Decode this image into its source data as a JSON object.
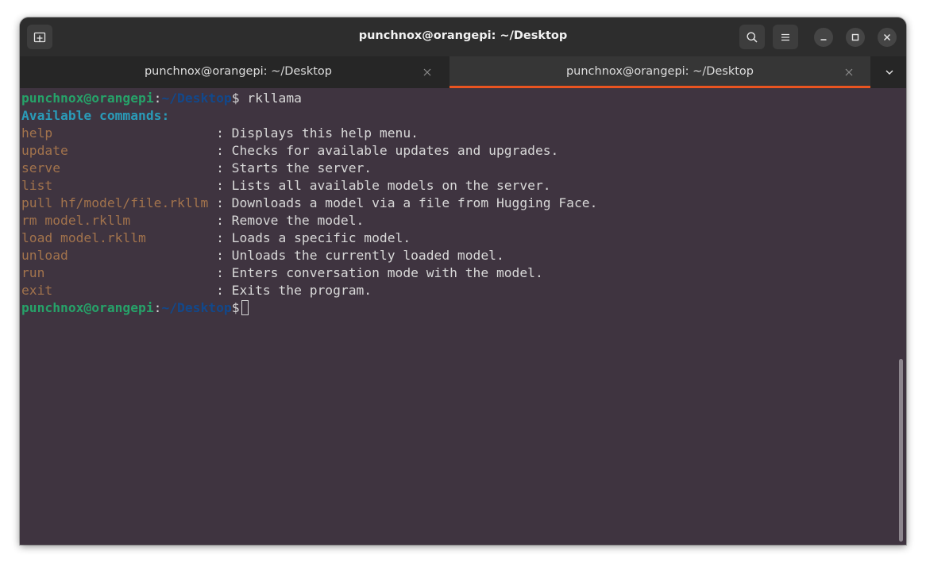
{
  "window": {
    "title": "punchnox@orangepi: ~/Desktop"
  },
  "tabs": [
    {
      "label": "punchnox@orangepi: ~/Desktop",
      "active": false
    },
    {
      "label": "punchnox@orangepi: ~/Desktop",
      "active": true
    }
  ],
  "icons": {
    "new_tab": "new-tab-icon",
    "search": "search-icon",
    "menu": "hamburger-menu-icon",
    "minimize": "minimize-icon",
    "maximize": "maximize-icon",
    "close": "close-icon",
    "tab_close": "close-icon",
    "tab_list": "chevron-down-icon"
  },
  "colors": {
    "background": "#3f3440",
    "prompt_user": "#26a269",
    "prompt_path": "#12488b",
    "heading": "#2a9bb8",
    "command": "#a2734c",
    "accent": "#e95420"
  },
  "terminal": {
    "prompt_user": "punchnox@orangepi",
    "prompt_colon": ":",
    "prompt_path": "~/Desktop",
    "prompt_symbol": "$",
    "first_input": " rkllama",
    "heading": "Available commands:",
    "commands": [
      {
        "cmd": "help                     ",
        "desc": ": Displays this help menu."
      },
      {
        "cmd": "update                   ",
        "desc": ": Checks for available updates and upgrades."
      },
      {
        "cmd": "serve                    ",
        "desc": ": Starts the server."
      },
      {
        "cmd": "list                     ",
        "desc": ": Lists all available models on the server."
      },
      {
        "cmd": "pull hf/model/file.rkllm ",
        "desc": ": Downloads a model via a file from Hugging Face."
      },
      {
        "cmd": "rm model.rkllm           ",
        "desc": ": Remove the model."
      },
      {
        "cmd": "load model.rkllm         ",
        "desc": ": Loads a specific model."
      },
      {
        "cmd": "unload                   ",
        "desc": ": Unloads the currently loaded model."
      },
      {
        "cmd": "run                      ",
        "desc": ": Enters conversation mode with the model."
      },
      {
        "cmd": "exit                     ",
        "desc": ": Exits the program."
      }
    ]
  }
}
